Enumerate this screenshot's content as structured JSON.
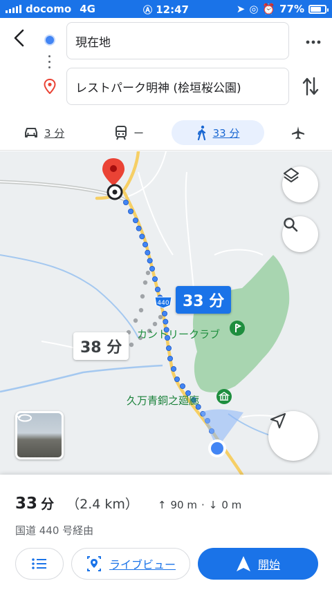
{
  "status": {
    "carrier": "docomo",
    "network": "4G",
    "time": "12:47",
    "battery": "77%",
    "battery_level": 0.77
  },
  "search": {
    "origin": "現在地",
    "destination": "レストパーク明神 (桧垣桜公園)"
  },
  "modes": {
    "drive": "3 分",
    "transit": "ー",
    "walk": "33 分"
  },
  "map": {
    "route_primary_time": "33 分",
    "route_alt_time": "38 分",
    "road_number": "440",
    "poi_country": "カントリークラブ",
    "poi_museum": "久万青銅之廻廊"
  },
  "summary": {
    "duration": "33",
    "duration_unit": "分",
    "distance": "（2.4 km）",
    "ascent": "90 m",
    "descent": "0 m",
    "via": "国道 440 号経由"
  },
  "buttons": {
    "live_view": "ライブビュー",
    "start": "開始"
  },
  "colors": {
    "accent": "#1a73e8",
    "route_primary": "#4285f4",
    "route_alt": "#a0a4a8",
    "park": "#a8d5b0",
    "destination_pin": "#ea4335"
  }
}
